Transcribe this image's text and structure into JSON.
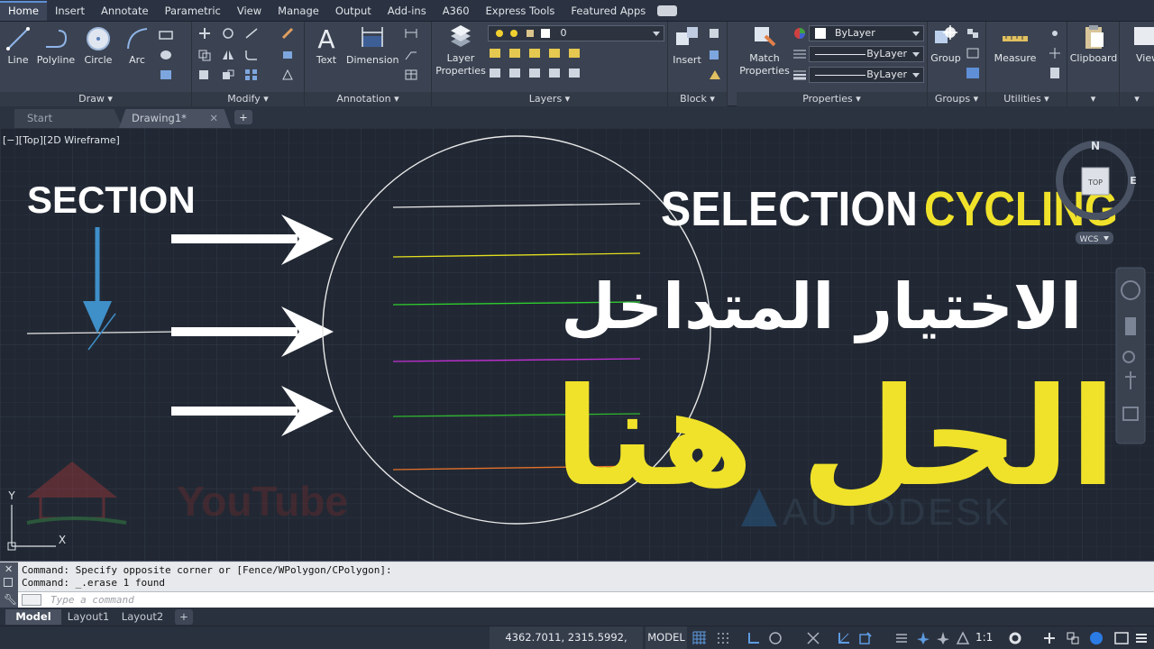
{
  "menu": {
    "tabs": [
      "Home",
      "Insert",
      "Annotate",
      "Parametric",
      "View",
      "Manage",
      "Output",
      "Add-ins",
      "A360",
      "Express Tools",
      "Featured Apps"
    ]
  },
  "ribbon": {
    "draw": {
      "title": "Draw",
      "line": "Line",
      "polyline": "Polyline",
      "circle": "Circle",
      "arc": "Arc"
    },
    "modify": {
      "title": "Modify"
    },
    "annotation": {
      "title": "Annotation",
      "text": "Text",
      "dimension": "Dimension"
    },
    "layers": {
      "title": "Layers",
      "layer_properties_1": "Layer",
      "layer_properties_2": "Properties",
      "current_layer": "0"
    },
    "block": {
      "title": "Block",
      "insert": "Insert"
    },
    "properties": {
      "title": "Properties",
      "match_1": "Match",
      "match_2": "Properties",
      "color": "ByLayer",
      "linetype": "ByLayer",
      "lineweight": "ByLayer"
    },
    "groups": {
      "title": "Groups",
      "group": "Group"
    },
    "utilities": {
      "title": "Utilities",
      "measure": "Measure"
    },
    "clipboard": {
      "title": "Clipboard"
    },
    "view_partial": "View"
  },
  "filetabs": {
    "start": "Start",
    "drawing": "Drawing1*"
  },
  "canvas": {
    "view_label": "[−][Top][2D Wireframe]",
    "overlay": {
      "section": "SECTION",
      "selection": "SELECTION",
      "cycling": "CYCLING",
      "arabic_line1": "الاختيار المتداخل",
      "arabic_line2": "الحل هنا"
    },
    "viewcube": {
      "north": "N",
      "east": "E",
      "face": "TOP",
      "wcs": "WCS"
    },
    "ucs": {
      "y": "Y",
      "x": "X"
    },
    "watermarks": {
      "youtube": "YouTube",
      "autodesk": "AUTODESK"
    },
    "line_colors": [
      "#e8e8e8",
      "#e3df1e",
      "#2fcf2f",
      "#c42fd6",
      "#2fb52f",
      "#e5712a"
    ],
    "accent_yellow": "#f0e22a"
  },
  "command": {
    "history": [
      "Command: Specify opposite corner or [Fence/WPolygon/CPolygon]:",
      "Command: _.erase 1 found"
    ],
    "placeholder": "Type a command"
  },
  "layout_tabs": [
    "Model",
    "Layout1",
    "Layout2"
  ],
  "status": {
    "coordinates": "4362.7011, 2315.5992, 0.0000",
    "model": "MODEL",
    "scale": "1:1"
  }
}
